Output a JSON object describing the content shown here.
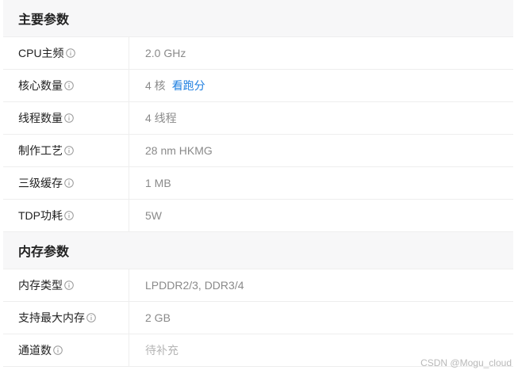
{
  "sections": [
    {
      "title": "主要参数",
      "rows": [
        {
          "label": "CPU主频",
          "value": "2.0 GHz"
        },
        {
          "label": "核心数量",
          "value": "4 核",
          "link": "看跑分"
        },
        {
          "label": "线程数量",
          "value": "4 线程"
        },
        {
          "label": "制作工艺",
          "value": "28 nm HKMG"
        },
        {
          "label": "三级缓存",
          "value": "1 MB"
        },
        {
          "label": "TDP功耗",
          "value": "5W"
        }
      ]
    },
    {
      "title": "内存参数",
      "rows": [
        {
          "label": "内存类型",
          "value": "LPDDR2/3, DDR3/4"
        },
        {
          "label": "支持最大内存",
          "value": "2 GB"
        },
        {
          "label": "通道数",
          "value": "待补充"
        }
      ]
    }
  ],
  "watermark": "CSDN @Mogu_cloud",
  "colors": {
    "link": "#1e7fe0",
    "header_bg": "#f7f7f8"
  }
}
